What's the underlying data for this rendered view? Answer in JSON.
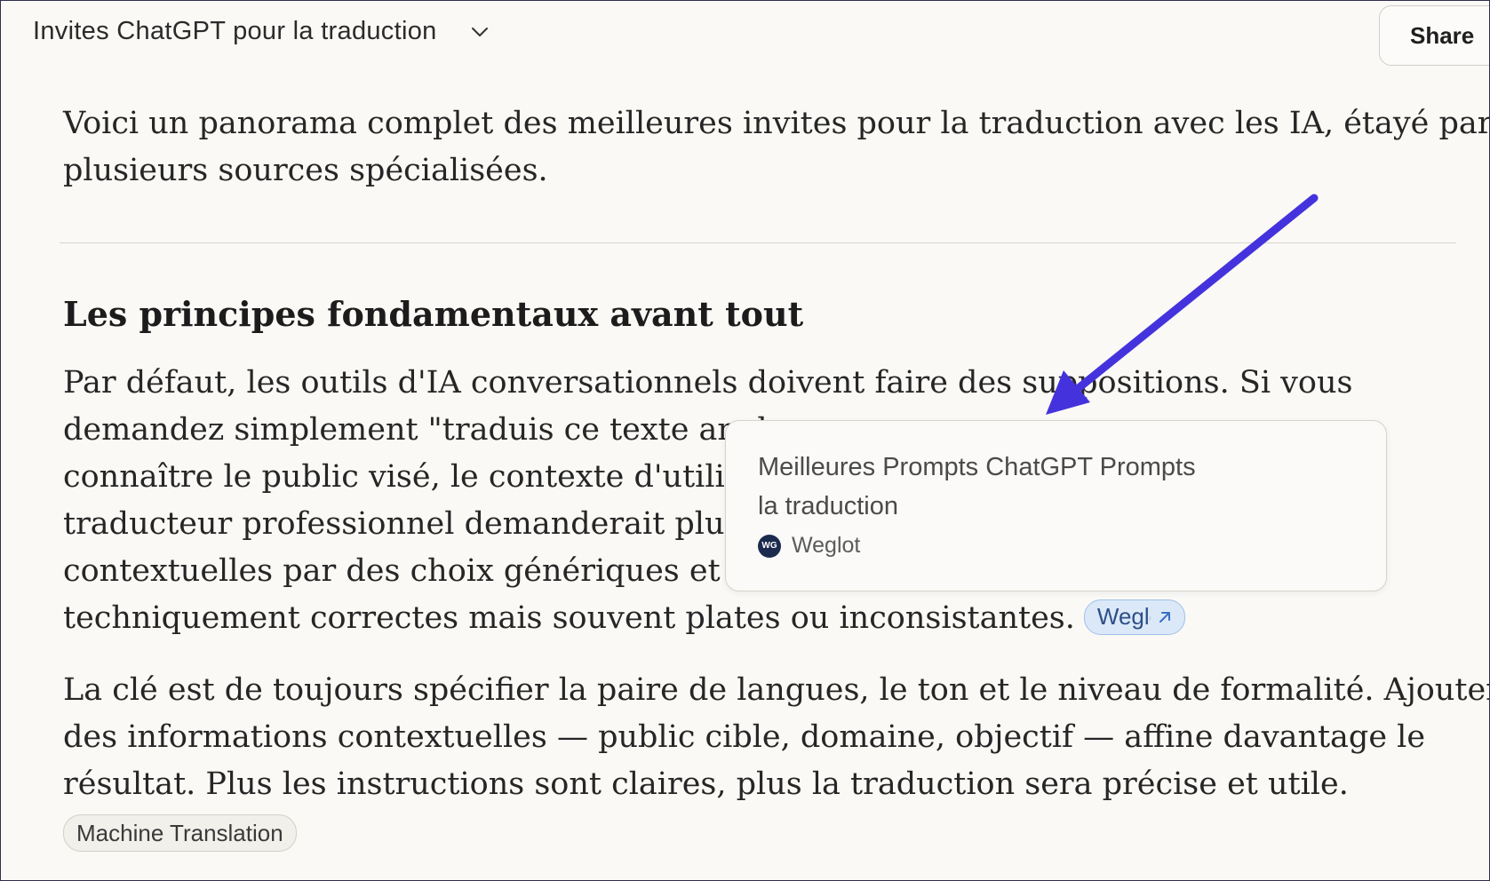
{
  "header": {
    "chat_title": "Invites ChatGPT pour la traduction",
    "share_label": "Share"
  },
  "intro": {
    "lines": [
      "Voici un panorama complet des meilleures invites pour la traduction avec les IA, étayé par",
      "plusieurs sources spécialisées."
    ]
  },
  "section": {
    "heading": "Les principes fondamentaux avant tout",
    "paragraph1": {
      "lines": [
        "Par défaut, les outils d'IA conversationnels doivent faire des suppositions. Si vous",
        "demandez simplement \"traduis ce texte angla",
        "connaître le public visé, le contexte d'utilisati",
        "traducteur professionnel demanderait plus d'",
        "contextuelles par des choix génériques et neu",
        "techniquement correctes mais souvent plates ou inconsistantes."
      ],
      "line2_tail": "e",
      "citation_label": "Weglot"
    },
    "paragraph2": {
      "lines": [
        "La clé est de toujours spécifier la paire de langues, le ton et le niveau de formalité. Ajouter",
        "des informations contextuelles — public cible, domaine, objectif — affine davantage le",
        "résultat. Plus les instructions sont claires, plus la traduction sera précise et utile."
      ]
    },
    "tag": "Machine Translation"
  },
  "popover": {
    "title_lines": [
      "Meilleures Prompts ChatGPT Prompts",
      "la traduction"
    ],
    "source_logo_text": "WG",
    "source_name": "Weglot"
  },
  "colors": {
    "background": "#faf9f6",
    "annotation_arrow": "#4433dd",
    "citation_chip": "#dbe8f8"
  },
  "icons": {
    "title_dropdown": "chevron-down-icon",
    "citation_link": "arrow-up-right-icon",
    "annotation": "pointer-arrow"
  }
}
